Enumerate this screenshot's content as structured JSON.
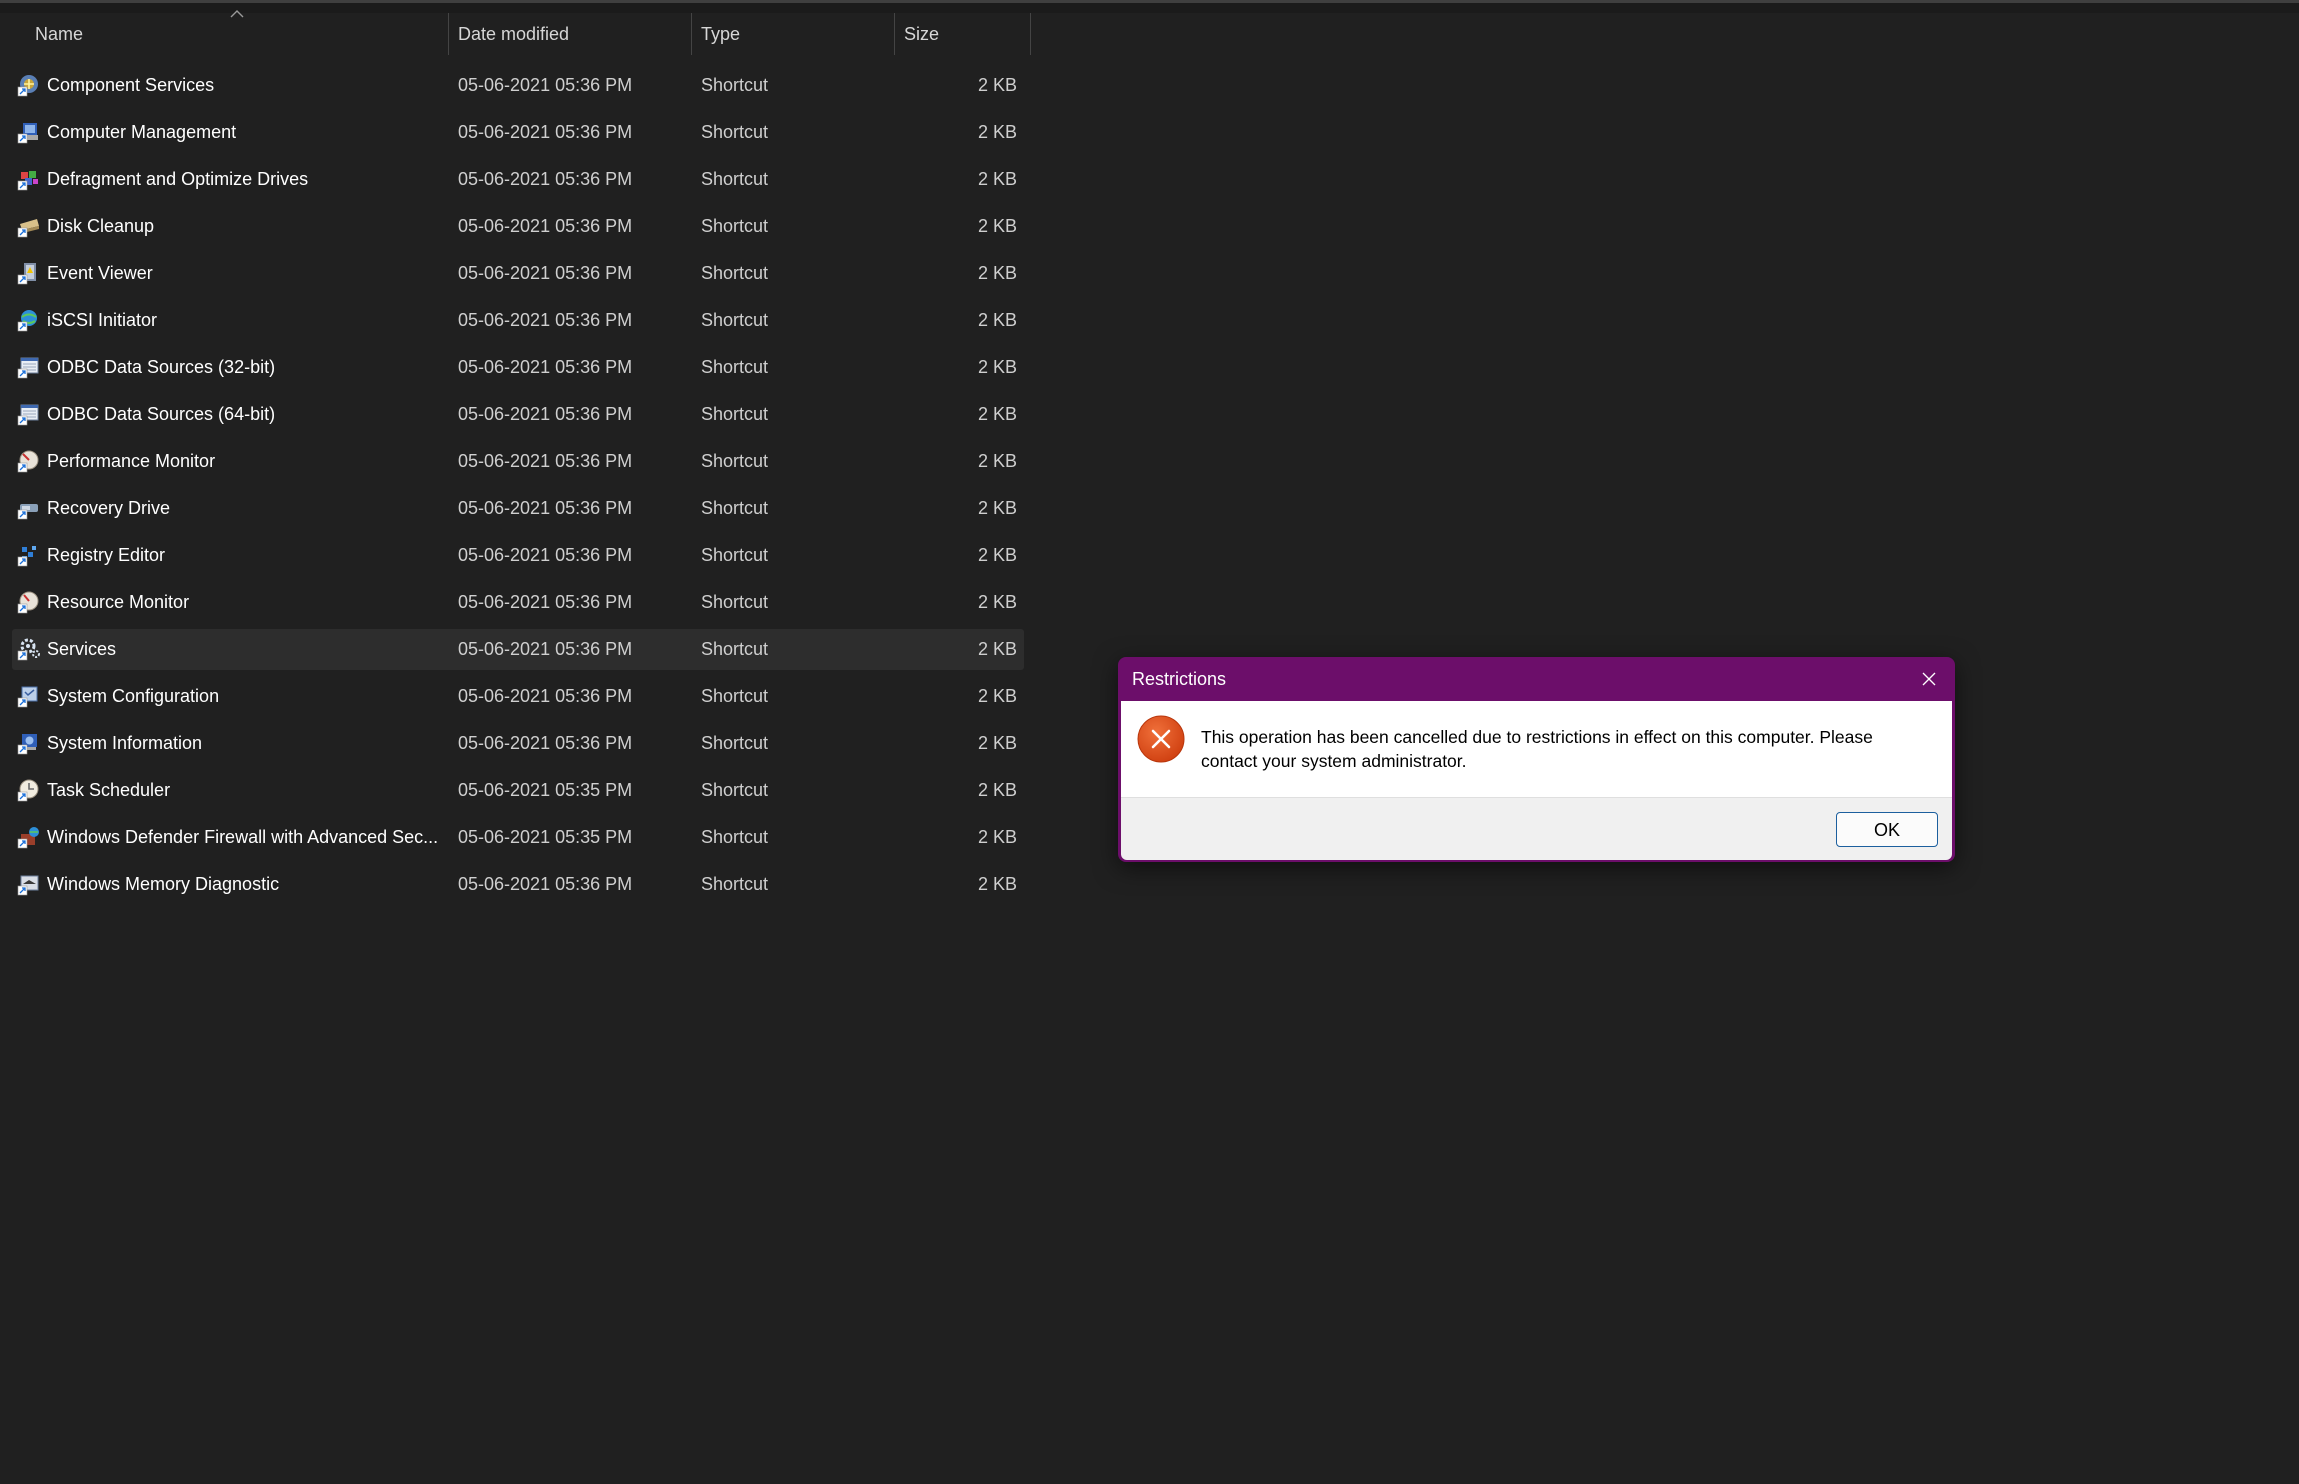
{
  "explorer": {
    "columns": {
      "name": "Name",
      "date_modified": "Date modified",
      "type": "Type",
      "size": "Size"
    },
    "sort": {
      "column": "name",
      "direction": "ascending"
    },
    "selected_index": 12,
    "files": [
      {
        "name": "Component Services",
        "date": "05-06-2021 05:36 PM",
        "type": "Shortcut",
        "size": "2 KB",
        "icon": "component-services-icon"
      },
      {
        "name": "Computer Management",
        "date": "05-06-2021 05:36 PM",
        "type": "Shortcut",
        "size": "2 KB",
        "icon": "computer-management-icon"
      },
      {
        "name": "Defragment and Optimize Drives",
        "date": "05-06-2021 05:36 PM",
        "type": "Shortcut",
        "size": "2 KB",
        "icon": "defragment-icon"
      },
      {
        "name": "Disk Cleanup",
        "date": "05-06-2021 05:36 PM",
        "type": "Shortcut",
        "size": "2 KB",
        "icon": "disk-cleanup-icon"
      },
      {
        "name": "Event Viewer",
        "date": "05-06-2021 05:36 PM",
        "type": "Shortcut",
        "size": "2 KB",
        "icon": "event-viewer-icon"
      },
      {
        "name": "iSCSI Initiator",
        "date": "05-06-2021 05:36 PM",
        "type": "Shortcut",
        "size": "2 KB",
        "icon": "iscsi-initiator-icon"
      },
      {
        "name": "ODBC Data Sources (32-bit)",
        "date": "05-06-2021 05:36 PM",
        "type": "Shortcut",
        "size": "2 KB",
        "icon": "odbc-icon"
      },
      {
        "name": "ODBC Data Sources (64-bit)",
        "date": "05-06-2021 05:36 PM",
        "type": "Shortcut",
        "size": "2 KB",
        "icon": "odbc-icon"
      },
      {
        "name": "Performance Monitor",
        "date": "05-06-2021 05:36 PM",
        "type": "Shortcut",
        "size": "2 KB",
        "icon": "performance-monitor-icon"
      },
      {
        "name": "Recovery Drive",
        "date": "05-06-2021 05:36 PM",
        "type": "Shortcut",
        "size": "2 KB",
        "icon": "recovery-drive-icon"
      },
      {
        "name": "Registry Editor",
        "date": "05-06-2021 05:36 PM",
        "type": "Shortcut",
        "size": "2 KB",
        "icon": "registry-editor-icon"
      },
      {
        "name": "Resource Monitor",
        "date": "05-06-2021 05:36 PM",
        "type": "Shortcut",
        "size": "2 KB",
        "icon": "resource-monitor-icon"
      },
      {
        "name": "Services",
        "date": "05-06-2021 05:36 PM",
        "type": "Shortcut",
        "size": "2 KB",
        "icon": "services-icon"
      },
      {
        "name": "System Configuration",
        "date": "05-06-2021 05:36 PM",
        "type": "Shortcut",
        "size": "2 KB",
        "icon": "system-configuration-icon"
      },
      {
        "name": "System Information",
        "date": "05-06-2021 05:36 PM",
        "type": "Shortcut",
        "size": "2 KB",
        "icon": "system-information-icon"
      },
      {
        "name": "Task Scheduler",
        "date": "05-06-2021 05:35 PM",
        "type": "Shortcut",
        "size": "2 KB",
        "icon": "task-scheduler-icon"
      },
      {
        "name": "Windows Defender Firewall with Advanced Sec...",
        "date": "05-06-2021 05:35 PM",
        "type": "Shortcut",
        "size": "2 KB",
        "icon": "firewall-icon"
      },
      {
        "name": "Windows Memory Diagnostic",
        "date": "05-06-2021 05:36 PM",
        "type": "Shortcut",
        "size": "2 KB",
        "icon": "memory-diagnostic-icon"
      }
    ]
  },
  "dialog": {
    "title": "Restrictions",
    "message": "This operation has been cancelled due to restrictions in effect on this computer. Please contact your system administrator.",
    "ok_label": "OK",
    "icon": "error-icon",
    "close_icon": "close-icon"
  },
  "colors": {
    "background": "#202020",
    "selected_row": "#2d2d2d",
    "dialog_titlebar": "#6c0e6a",
    "error_red": "#e0531c",
    "ok_border": "#1c5f9e"
  }
}
